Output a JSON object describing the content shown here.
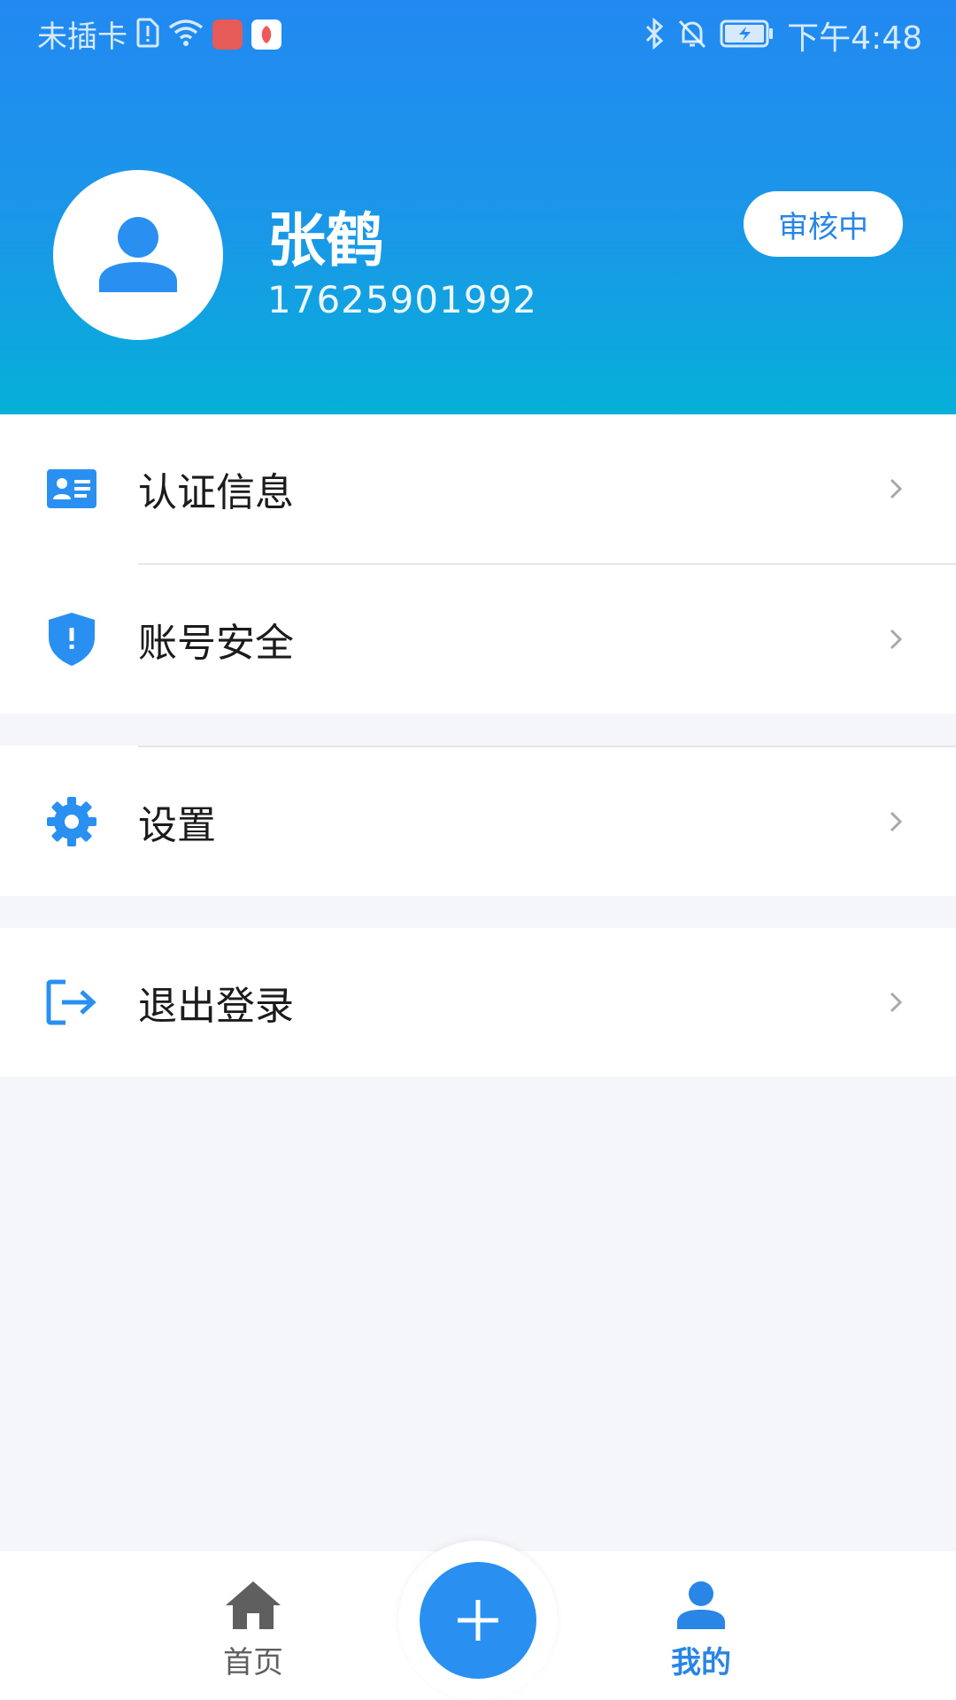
{
  "status_bar": {
    "carrier": "未插卡",
    "time": "下午4:48",
    "icons": [
      "sim-alert-icon",
      "wifi-icon",
      "app-store-icon",
      "app-icon",
      "bluetooth-icon",
      "mute-icon",
      "battery-charging-icon"
    ]
  },
  "profile": {
    "name": "张鹤",
    "phone": "17625901992",
    "status": "审核中",
    "avatar_icon": "person-icon"
  },
  "menu": {
    "auth": {
      "label": "认证信息",
      "icon": "id-card-icon"
    },
    "security": {
      "label": "账号安全",
      "icon": "shield-icon"
    },
    "settings": {
      "label": "设置",
      "icon": "gear-icon"
    },
    "logout": {
      "label": "退出登录",
      "icon": "logout-icon"
    }
  },
  "nav": {
    "home": {
      "label": "首页",
      "icon": "home-icon"
    },
    "add": {
      "icon": "plus-icon"
    },
    "mine": {
      "label": "我的",
      "icon": "person-icon",
      "active": true
    }
  },
  "colors": {
    "primary": "#2990f2",
    "header_top": "#2289f2",
    "header_bottom": "#06b0d8",
    "background": "#f4f6f9"
  }
}
